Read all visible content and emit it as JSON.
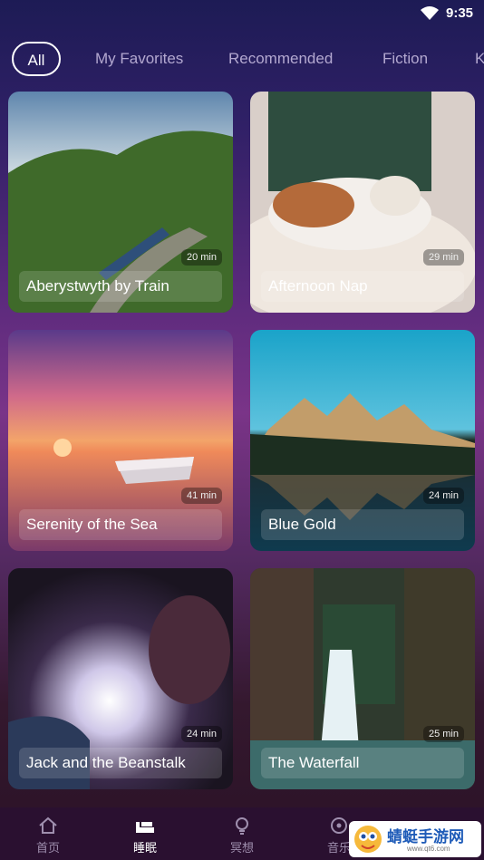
{
  "status": {
    "time": "9:35"
  },
  "tabs": [
    {
      "label": "All",
      "active": true
    },
    {
      "label": "My Favorites"
    },
    {
      "label": "Recommended"
    },
    {
      "label": "Fiction"
    },
    {
      "label": "K"
    }
  ],
  "cards": [
    {
      "title": "Aberystwyth by Train",
      "duration": "20 min"
    },
    {
      "title": "Afternoon Nap",
      "duration": "29 min"
    },
    {
      "title": "Serenity of the Sea",
      "duration": "41 min"
    },
    {
      "title": "Blue Gold",
      "duration": "24 min"
    },
    {
      "title": "Jack and the Beanstalk",
      "duration": "24 min"
    },
    {
      "title": "The Waterfall",
      "duration": "25 min"
    }
  ],
  "nav": [
    {
      "label": "首页",
      "icon": "home-icon"
    },
    {
      "label": "睡眠",
      "icon": "sleep-icon",
      "active": true
    },
    {
      "label": "冥想",
      "icon": "meditation-icon"
    },
    {
      "label": "音乐",
      "icon": "music-icon"
    }
  ],
  "watermark": {
    "text": "蜻蜓手游网",
    "url": "www.qt6.com"
  }
}
